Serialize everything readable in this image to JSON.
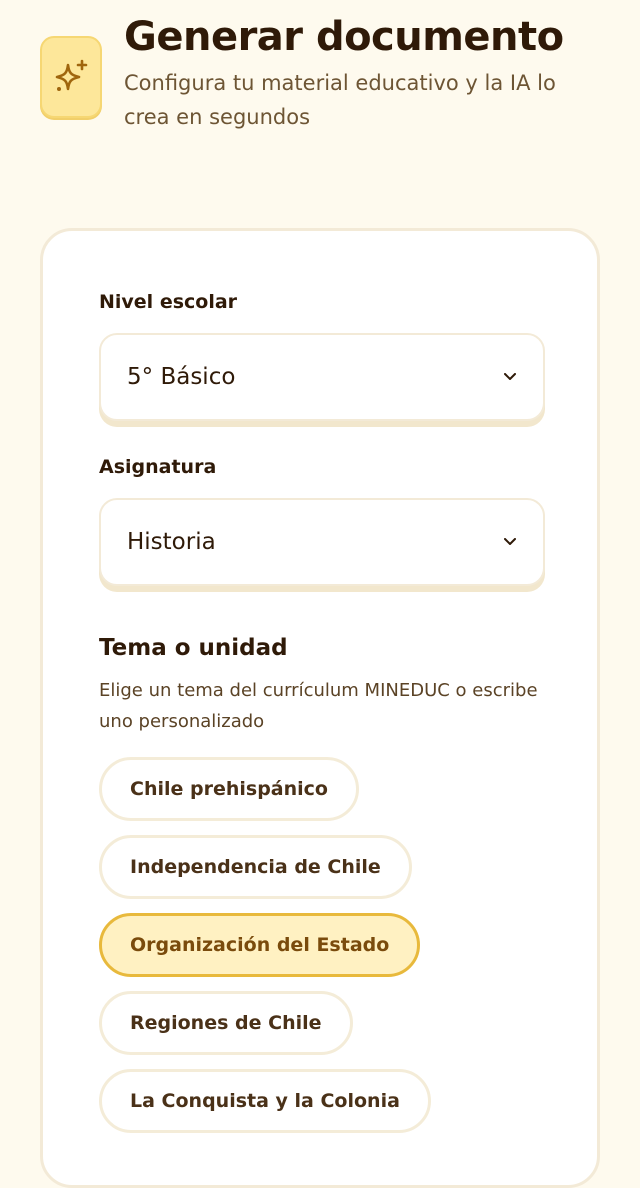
{
  "header": {
    "icon": "sparkles-icon",
    "title": "Generar documento",
    "subtitle": "Configura tu material educativo y la IA lo crea en segundos"
  },
  "form": {
    "level": {
      "label": "Nivel escolar",
      "value": "5° Básico"
    },
    "subject": {
      "label": "Asignatura",
      "value": "Historia"
    },
    "topic": {
      "title": "Tema o unidad",
      "hint": "Elige un tema del currículum MINEDUC o escribe uno personalizado",
      "chips": [
        {
          "label": "Chile prehispánico",
          "selected": false
        },
        {
          "label": "Independencia de Chile",
          "selected": false
        },
        {
          "label": "Organización del Estado",
          "selected": true
        },
        {
          "label": "Regiones de Chile",
          "selected": false
        },
        {
          "label": "La Conquista y la Colonia",
          "selected": false
        }
      ]
    }
  },
  "colors": {
    "background": "#fefaee",
    "accent": "#e8b93c",
    "selected_chip_bg": "#fff1c2",
    "text": "#2f1a08"
  }
}
